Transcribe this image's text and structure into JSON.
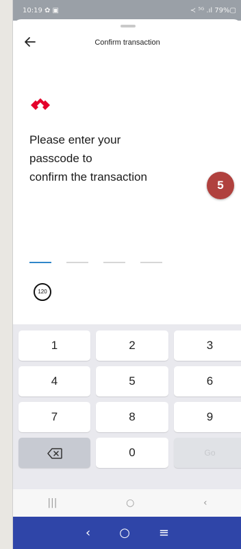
{
  "status_bar": {
    "time": "10:19 ✿ ▣",
    "right": "≺ ⁵ᴳ .ıl 79%▢"
  },
  "header": {
    "back_icon": "arrow-left-icon",
    "title": "Confirm transaction"
  },
  "logo": {
    "name": "bank-logo",
    "color": "#e4002b"
  },
  "prompt": "Please enter your\npasscode to\nconfirm the transaction",
  "step_badge": {
    "text": "5",
    "color": "#b0413e"
  },
  "passcode": {
    "length": 4,
    "filled": 1,
    "active_color": "#2f86c9"
  },
  "timer": {
    "text": "120"
  },
  "keypad": {
    "keys": [
      "1",
      "2",
      "3",
      "4",
      "5",
      "6",
      "7",
      "8",
      "9"
    ],
    "zero": "0",
    "go": "Go",
    "delete_icon": "backspace-icon"
  },
  "system_nav": {
    "recents": "|||",
    "home": "○",
    "back": "‹"
  },
  "bottom_bar": {
    "back": "‹",
    "home": "○",
    "menu": "≡",
    "color": "#2f45a8"
  }
}
